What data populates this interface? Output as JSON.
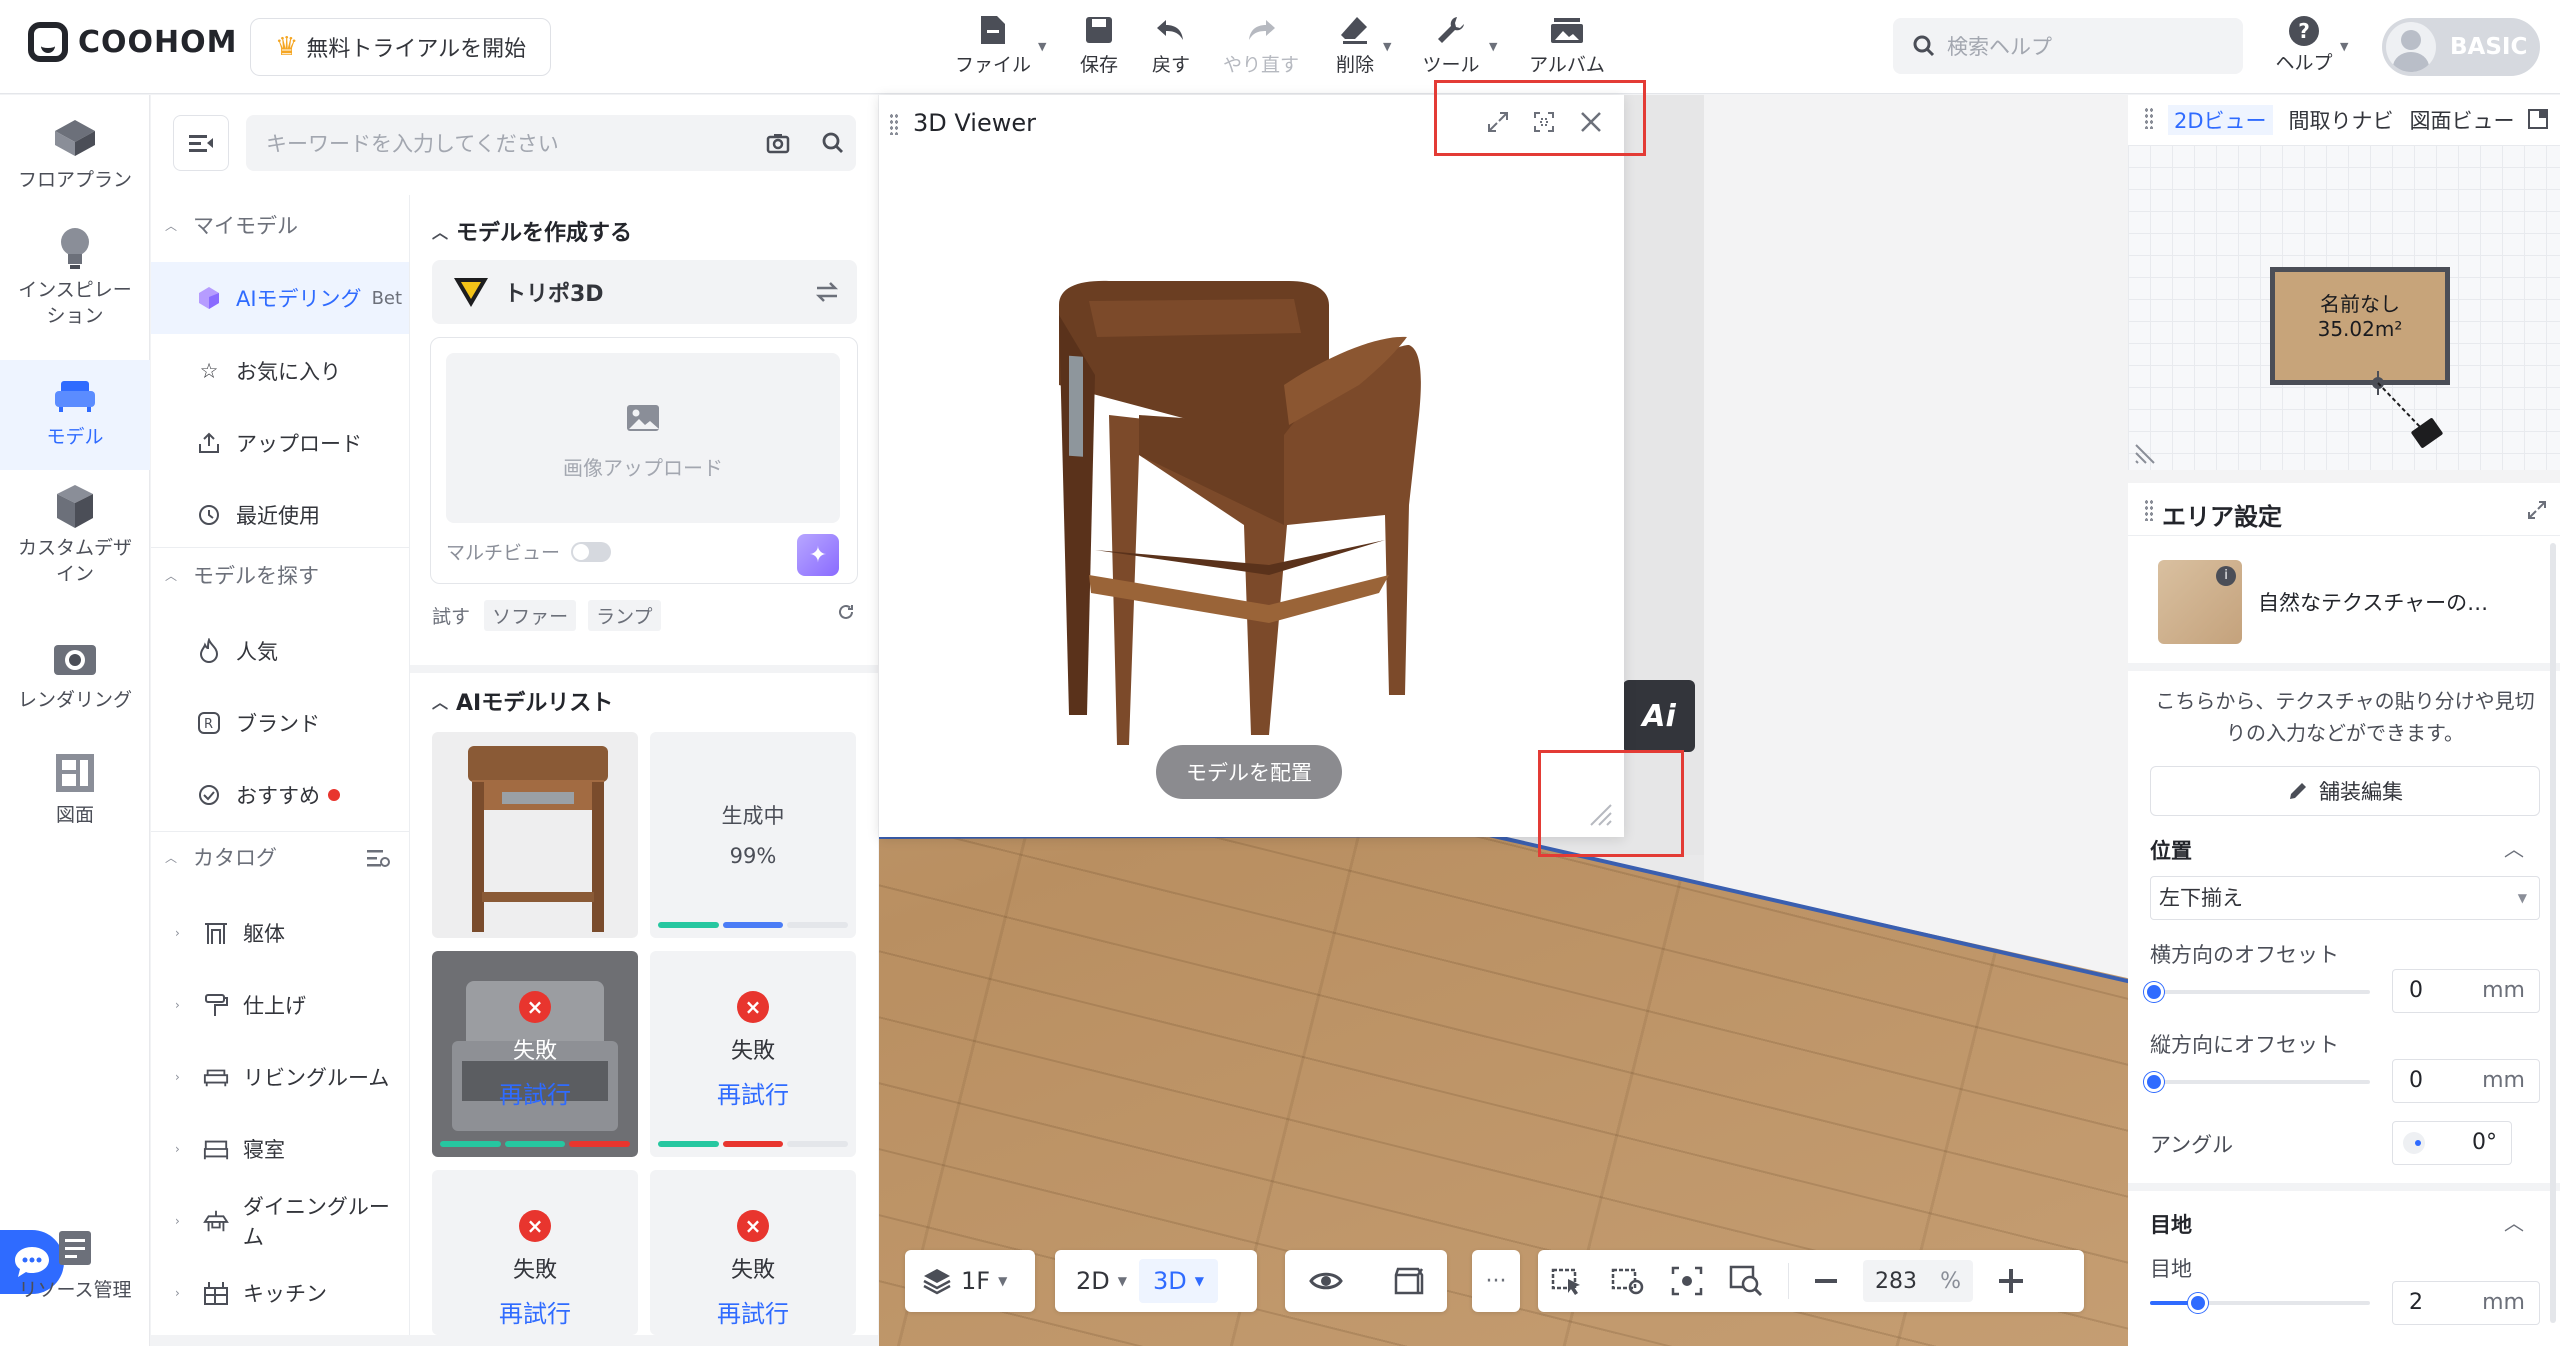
{
  "topbar": {
    "logo": "COOHOM",
    "trial_button": "無料トライアルを開始",
    "tools": [
      {
        "label": "ファイル",
        "icon": "file-icon",
        "dropdown": true
      },
      {
        "label": "保存",
        "icon": "save-icon",
        "dropdown": false
      },
      {
        "label": "戻す",
        "icon": "undo-icon",
        "dropdown": false
      },
      {
        "label": "やり直す",
        "icon": "redo-icon",
        "dropdown": false,
        "disabled": true
      },
      {
        "label": "削除",
        "icon": "eraser-icon",
        "dropdown": true
      },
      {
        "label": "ツール",
        "icon": "wrench-icon",
        "dropdown": true
      },
      {
        "label": "アルバム",
        "icon": "album-icon",
        "dropdown": false
      }
    ],
    "help_search_placeholder": "検索ヘルプ",
    "help_label": "ヘルプ",
    "plan_badge": "BASIC"
  },
  "rail": [
    {
      "label": "フロアプラン",
      "icon": "floorplan-icon"
    },
    {
      "label": "インスピレーション",
      "icon": "lightbulb-icon"
    },
    {
      "label": "モデル",
      "icon": "sofa-icon",
      "active": true
    },
    {
      "label": "カスタムデザイン",
      "icon": "cabinet-icon"
    },
    {
      "label": "レンダリング",
      "icon": "camera-icon"
    },
    {
      "label": "図面",
      "icon": "drawing-icon"
    },
    {
      "label": "リソース管理",
      "icon": "resource-icon"
    }
  ],
  "panel": {
    "search_placeholder": "キーワードを入力してください",
    "my_models": "マイモデル",
    "ai_modeling": "AIモデリング",
    "ai_modeling_badge": "Bet",
    "favorites": "お気に入り",
    "upload": "アップロード",
    "recent": "最近使用",
    "find_models": "モデルを探す",
    "popular": "人気",
    "brand": "ブランド",
    "recommended": "おすすめ",
    "catalog": "カタログ",
    "catalog_items": [
      "躯体",
      "仕上げ",
      "リビングルーム",
      "寝室",
      "ダイニングルーム",
      "キッチン"
    ],
    "create_model": "モデルを作成する",
    "tripo": "トリポ3D",
    "image_upload": "画像アップロード",
    "multiview": "マルチビュー",
    "try_label": "試す",
    "try_chips": [
      "ソファー",
      "ランプ"
    ],
    "ai_model_list": "AIモデルリスト",
    "generating": "生成中",
    "generating_progress": "99%",
    "failed": "失敗",
    "retry": "再試行"
  },
  "viewer": {
    "title": "3D Viewer",
    "place_button": "モデルを配置"
  },
  "minimap": {
    "tabs": [
      "2Dビュー",
      "間取りナビ",
      "図面ビュー"
    ],
    "room_name": "名前なし",
    "room_area": "35.02m²"
  },
  "area": {
    "title": "エリア設定",
    "material_name": "自然なテクスチャーの…",
    "description": "こちらから、テクスチャの貼り分けや見切りの入力などができます。",
    "paving_button": "舗装編集",
    "position_section": "位置",
    "alignment": "左下揃え",
    "h_offset_label": "横方向のオフセット",
    "h_offset_value": "0",
    "v_offset_label": "縦方向にオフセット",
    "v_offset_value": "0",
    "angle_label": "アングル",
    "angle_value": "0°",
    "joint_section": "目地",
    "joint_label": "目地",
    "joint_value": "2",
    "unit": "mm"
  },
  "bottombar": {
    "floor": "1F",
    "view_2d": "2D",
    "view_3d": "3D",
    "zoom": "283",
    "zoom_unit": "%"
  },
  "colors": {
    "accent": "#2f6bff",
    "danger": "#e8352e",
    "highlight_box": "#e33b35"
  }
}
